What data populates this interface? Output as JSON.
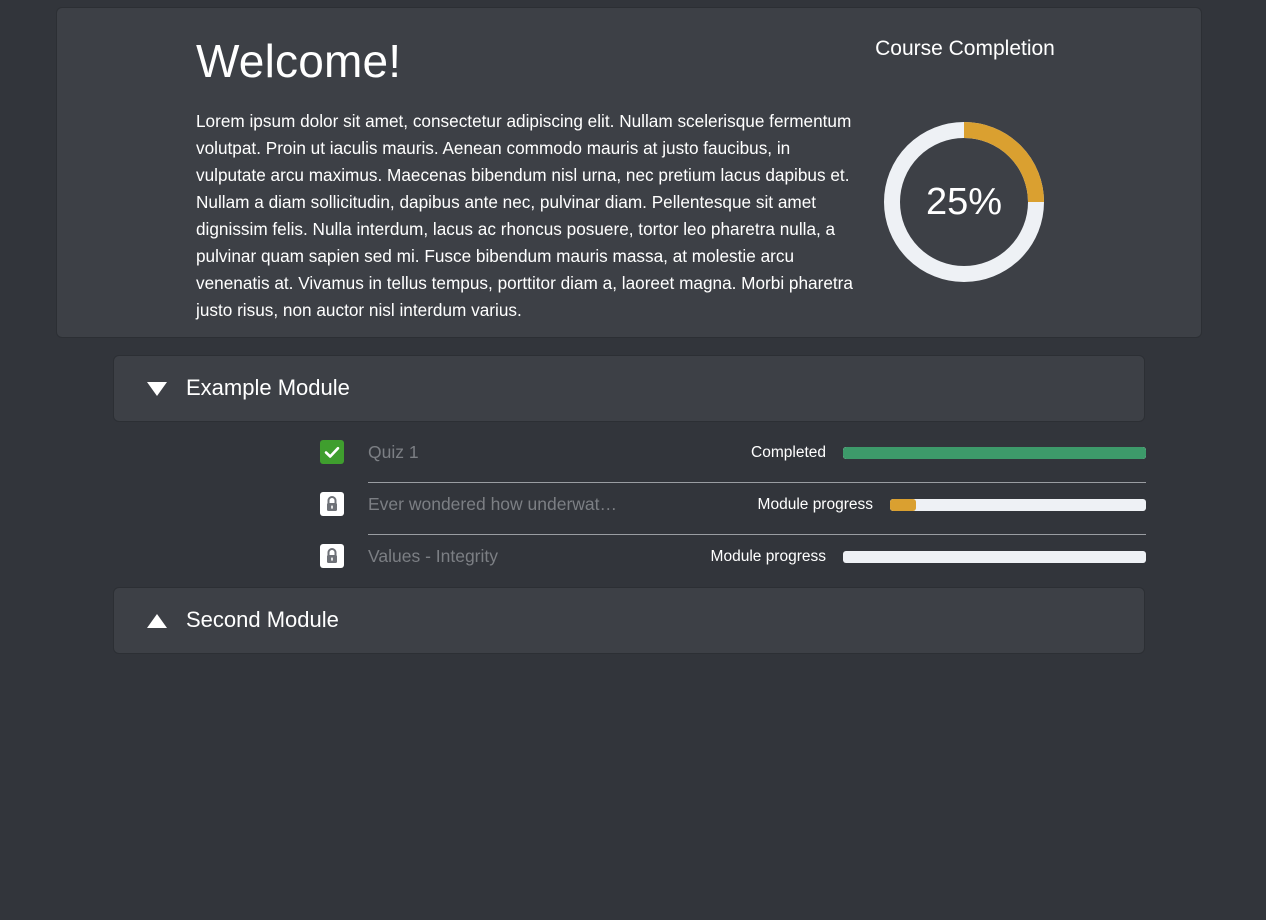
{
  "welcome": {
    "title": "Welcome!",
    "body": "Lorem ipsum dolor sit amet, consectetur adipiscing elit. Nullam scelerisque fermentum volutpat. Proin ut iaculis mauris. Aenean commodo mauris at justo faucibus, in vulputate arcu maximus. Maecenas bibendum nisl urna, nec pretium lacus dapibus et. Nullam a diam sollicitudin, dapibus ante nec, pulvinar diam. Pellentesque sit amet dignissim felis. Nulla interdum, lacus ac rhoncus posuere, tortor leo pharetra nulla, a pulvinar quam sapien sed mi. Fusce bibendum mauris massa, at molestie arcu venenatis at. Vivamus in tellus tempus, porttitor diam a, laoreet magna. Morbi pharetra justo risus, non auctor nisl interdum varius."
  },
  "completion": {
    "title": "Course Completion",
    "percent_label": "25%",
    "fraction": 0.25,
    "fill_color": "#daa030",
    "track_color": "#eef1f5"
  },
  "modules": [
    {
      "title": "Example Module",
      "expanded": true,
      "lessons": [
        {
          "title": "Quiz 1",
          "status_icon": "check-icon",
          "progress_label": "Completed",
          "progress": 1.0,
          "fill_color": "#3d9a6a"
        },
        {
          "title": "Ever wondered how underwater ...",
          "status_icon": "lock-icon",
          "progress_label": "Module progress",
          "progress": 0.1,
          "fill_color": "#daa030"
        },
        {
          "title": "Values - Integrity",
          "status_icon": "lock-icon",
          "progress_label": "Module progress",
          "progress": 0.0,
          "fill_color": "#daa030"
        }
      ]
    },
    {
      "title": "Second Module",
      "expanded": false
    }
  ]
}
